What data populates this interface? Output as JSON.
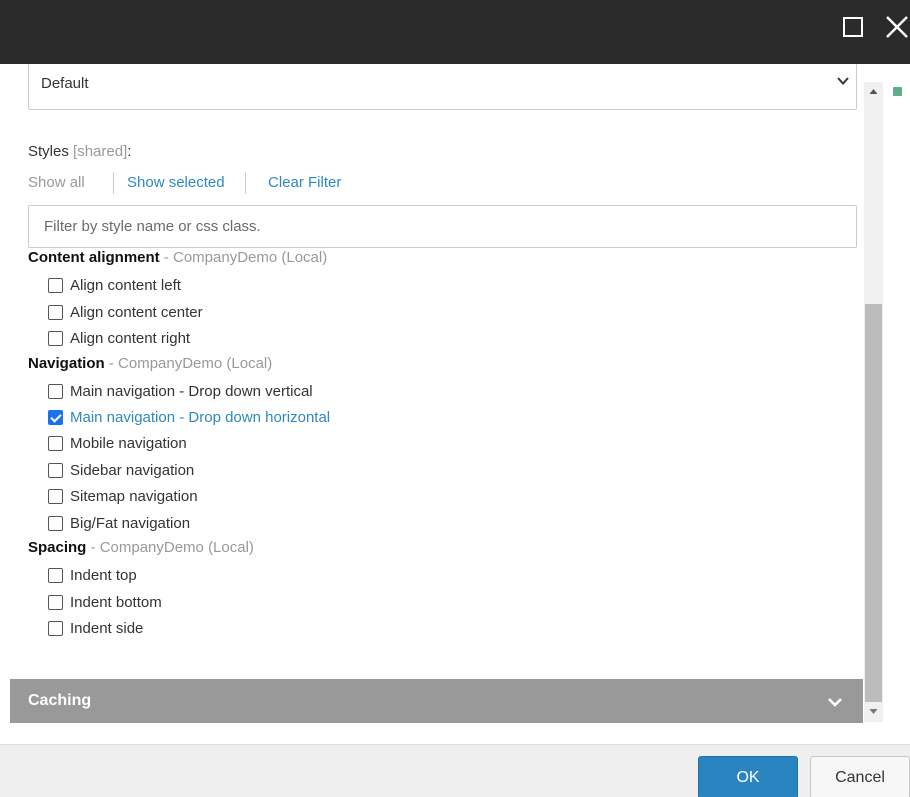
{
  "window": {
    "maximize_icon": "maximize-icon",
    "close_icon": "close-icon"
  },
  "variant_select": {
    "value": "Default",
    "icon": "chevron-down-icon"
  },
  "styles": {
    "label": "Styles",
    "label_shared": "[shared]",
    "label_colon": ":",
    "links": {
      "show_all": "Show all",
      "show_selected": "Show selected",
      "clear_filter": "Clear Filter"
    },
    "filter_placeholder": "Filter by style name or css class.",
    "groups": [
      {
        "name": "Content alignment",
        "source": " - CompanyDemo (Local)",
        "options": [
          {
            "label": "Align content left",
            "checked": false
          },
          {
            "label": "Align content center",
            "checked": false
          },
          {
            "label": "Align content right",
            "checked": false
          }
        ]
      },
      {
        "name": "Navigation",
        "source": " - CompanyDemo (Local)",
        "options": [
          {
            "label": "Main navigation - Drop down vertical",
            "checked": false
          },
          {
            "label": "Main navigation - Drop down horizontal",
            "checked": true
          },
          {
            "label": "Mobile navigation",
            "checked": false
          },
          {
            "label": "Sidebar navigation",
            "checked": false
          },
          {
            "label": "Sitemap navigation",
            "checked": false
          },
          {
            "label": "Big/Fat navigation",
            "checked": false
          }
        ]
      },
      {
        "name": "Spacing",
        "source": " - CompanyDemo (Local)",
        "options": [
          {
            "label": "Indent top",
            "checked": false
          },
          {
            "label": "Indent bottom",
            "checked": false
          },
          {
            "label": "Indent side",
            "checked": false
          }
        ]
      }
    ]
  },
  "caching": {
    "label": "Caching",
    "icon": "chevron-down-icon"
  },
  "footer": {
    "ok_label": "OK",
    "cancel_label": "Cancel"
  },
  "colors": {
    "title_bar": "#2b2b2b",
    "link": "#2f89c0",
    "section_bar": "#999999",
    "primary_button": "#2a84c0",
    "checkbox_checked": "#1a73e8"
  }
}
